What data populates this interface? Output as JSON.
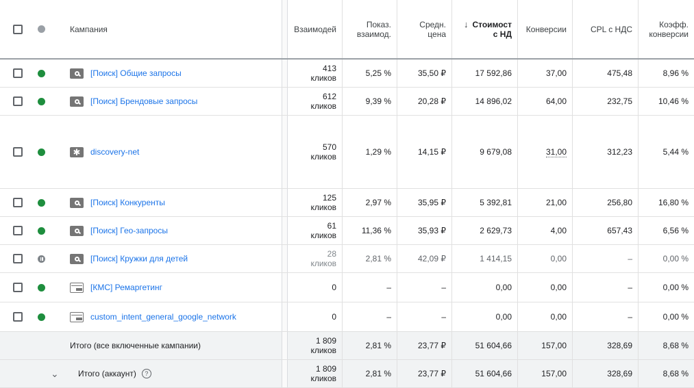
{
  "columns": {
    "campaign": "Кампания",
    "interactions": "Взаимодей",
    "interaction_rate": "Показ. взаимод.",
    "avg_cost": "Средн. цена",
    "cost": "Стоимост с НД",
    "conversions": "Конверсии",
    "cpl": "CPL с НДС",
    "conv_rate": "Коэфф. конверсии",
    "sort_icon": "arrow-down-icon"
  },
  "rows": [
    {
      "status": "enabled",
      "type": "search",
      "name": "[Поиск] Общие запросы",
      "interactions": "413",
      "unit": "кликов",
      "rate": "5,25 %",
      "avg": "35,50 ₽",
      "cost": "17 592,86",
      "conv": "37,00",
      "cpl": "475,48",
      "cr": "8,96 %"
    },
    {
      "status": "enabled",
      "type": "search",
      "name": "[Поиск] Брендовые запросы",
      "interactions": "612",
      "unit": "кликов",
      "rate": "9,39 %",
      "avg": "20,28 ₽",
      "cost": "14 896,02",
      "conv": "64,00",
      "cpl": "232,75",
      "cr": "10,46 %"
    },
    {
      "status": "enabled",
      "type": "discovery",
      "name": "discovery-net",
      "interactions": "570",
      "unit": "кликов",
      "rate": "1,29 %",
      "avg": "14,15 ₽",
      "cost": "9 679,08",
      "conv": "31,00",
      "cpl": "312,23",
      "cr": "5,44 %"
    },
    {
      "status": "enabled",
      "type": "search",
      "name": "[Поиск] Конкуренты",
      "interactions": "125",
      "unit": "кликов",
      "rate": "2,97 %",
      "avg": "35,95 ₽",
      "cost": "5 392,81",
      "conv": "21,00",
      "cpl": "256,80",
      "cr": "16,80 %"
    },
    {
      "status": "enabled",
      "type": "search",
      "name": "[Поиск] Гео-запросы",
      "interactions": "61",
      "unit": "кликов",
      "rate": "11,36 %",
      "avg": "35,93 ₽",
      "cost": "2 629,73",
      "conv": "4,00",
      "cpl": "657,43",
      "cr": "6,56 %"
    },
    {
      "status": "paused",
      "type": "search",
      "name": "[Поиск] Кружки для детей",
      "interactions": "28",
      "unit": "кликов",
      "rate": "2,81 %",
      "avg": "42,09 ₽",
      "cost": "1 414,15",
      "conv": "0,00",
      "cpl": "–",
      "cr": "0,00 %"
    },
    {
      "status": "enabled",
      "type": "display",
      "name": "[КМС] Ремаргетинг",
      "interactions": "0",
      "unit": "",
      "rate": "–",
      "avg": "–",
      "cost": "0,00",
      "conv": "0,00",
      "cpl": "–",
      "cr": "0,00 %"
    },
    {
      "status": "enabled",
      "type": "display",
      "name": "custom_intent_general_google_network",
      "interactions": "0",
      "unit": "",
      "rate": "–",
      "avg": "–",
      "cost": "0,00",
      "conv": "0,00",
      "cpl": "–",
      "cr": "0,00 %"
    }
  ],
  "totals": [
    {
      "label": "Итого (все включенные кампании)",
      "interactions": "1 809",
      "unit": "кликов",
      "rate": "2,81 %",
      "avg": "23,77 ₽",
      "cost": "51 604,66",
      "conv": "157,00",
      "cpl": "328,69",
      "cr": "8,68 %"
    },
    {
      "label": "Итого (аккаунт)",
      "interactions": "1 809",
      "unit": "кликов",
      "rate": "2,81 %",
      "avg": "23,77 ₽",
      "cost": "51 604,66",
      "conv": "157,00",
      "cpl": "328,69",
      "cr": "8,68 %",
      "help_icon": "?",
      "expand_icon": "chevron-down-icon"
    }
  ],
  "colors": {
    "enabled": "#1e8e3e",
    "paused": "#80868b",
    "link": "#1a73e8"
  }
}
